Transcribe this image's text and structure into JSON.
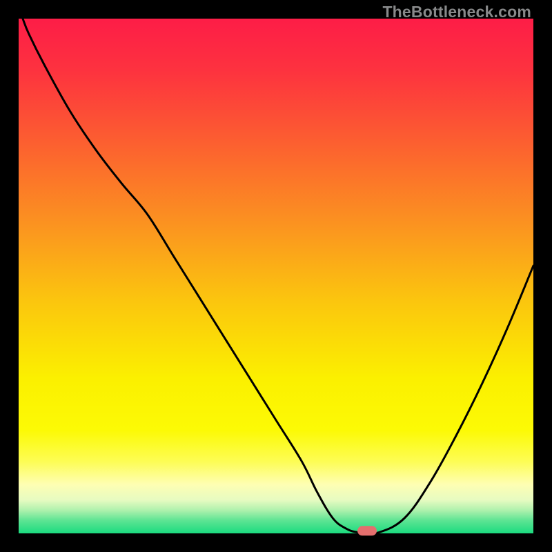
{
  "watermark": "TheBottleneck.com",
  "colors": {
    "black": "#000000",
    "curve": "#000000",
    "marker_fill": "#e46f6e",
    "gradient_stops": [
      {
        "offset": 0.0,
        "color": "#fd1d47"
      },
      {
        "offset": 0.1,
        "color": "#fd323f"
      },
      {
        "offset": 0.25,
        "color": "#fc622f"
      },
      {
        "offset": 0.4,
        "color": "#fb9320"
      },
      {
        "offset": 0.55,
        "color": "#fbc60e"
      },
      {
        "offset": 0.7,
        "color": "#fbf000"
      },
      {
        "offset": 0.8,
        "color": "#fcfa05"
      },
      {
        "offset": 0.86,
        "color": "#fdfd54"
      },
      {
        "offset": 0.905,
        "color": "#fefeb3"
      },
      {
        "offset": 0.935,
        "color": "#e7fbc1"
      },
      {
        "offset": 0.955,
        "color": "#aff1ad"
      },
      {
        "offset": 0.975,
        "color": "#5de493"
      },
      {
        "offset": 1.0,
        "color": "#1bdb7f"
      }
    ]
  },
  "chart_data": {
    "type": "line",
    "title": "",
    "xlabel": "",
    "ylabel": "",
    "xlim": [
      0,
      100
    ],
    "ylim": [
      0,
      100
    ],
    "series": [
      {
        "name": "bottleneck-curve",
        "x": [
          0.8,
          2,
          5,
          10,
          15,
          20,
          25,
          30,
          35,
          40,
          45,
          50,
          55,
          58,
          61,
          63.5,
          66,
          70,
          75,
          80,
          85,
          90,
          95,
          100
        ],
        "y": [
          100,
          97,
          91,
          82,
          74.5,
          68,
          62,
          54,
          46,
          38,
          30,
          22,
          14,
          8,
          3,
          1,
          0.2,
          0.2,
          3,
          10,
          19,
          29,
          40,
          52
        ]
      }
    ],
    "optimum_marker": {
      "x": 67.7,
      "y": 0.5
    },
    "grid": false,
    "legend": false
  }
}
